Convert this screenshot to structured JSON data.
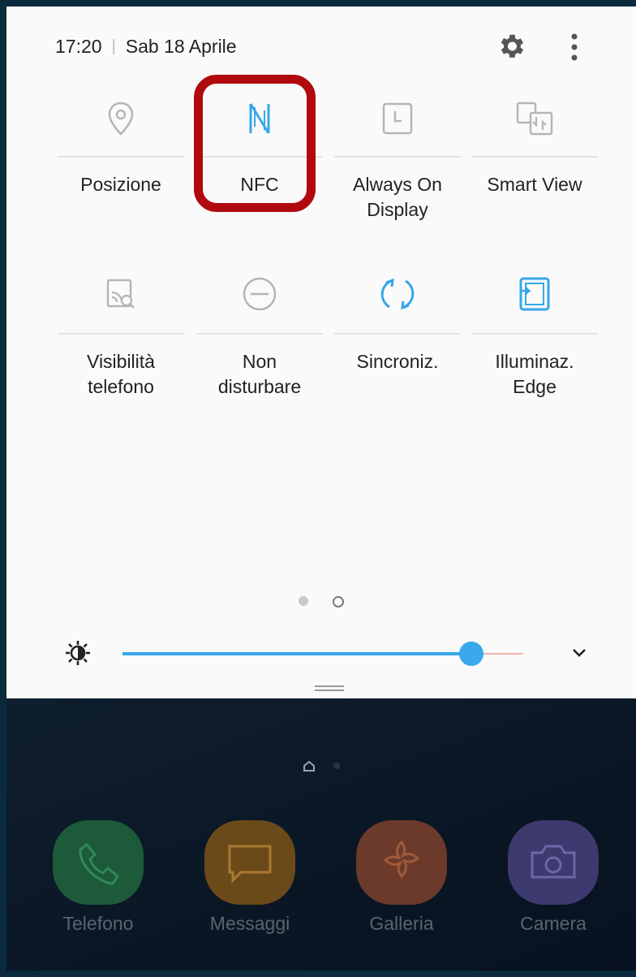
{
  "status_bar": {
    "time": "17:20",
    "date": "Sab 18 Aprile"
  },
  "tiles": [
    {
      "label": "Posizione",
      "icon": "location-icon",
      "active": false
    },
    {
      "label": "NFC",
      "icon": "nfc-icon",
      "active": true
    },
    {
      "label": "Always On\nDisplay",
      "icon": "always-on-display-icon",
      "active": false
    },
    {
      "label": "Smart View",
      "icon": "smart-view-icon",
      "active": false
    },
    {
      "label": "Visibilità\ntelefono",
      "icon": "phone-visibility-icon",
      "active": false
    },
    {
      "label": "Non\ndisturbare",
      "icon": "do-not-disturb-icon",
      "active": false
    },
    {
      "label": "Sincroniz.",
      "icon": "sync-icon",
      "active": true
    },
    {
      "label": "Illuminaz.\nEdge",
      "icon": "edge-lighting-icon",
      "active": true
    }
  ],
  "pager": {
    "current": 1,
    "total": 2
  },
  "brightness": {
    "level": 0.87
  },
  "colors": {
    "accent": "#35a7e8",
    "highlight": "#b00a0e",
    "inactive_icon": "#b5b5b5"
  },
  "dock": [
    {
      "label": "Telefono",
      "icon": "phone-icon",
      "color": "#1d5a3a"
    },
    {
      "label": "Messaggi",
      "icon": "message-icon",
      "color": "#6b4a1a"
    },
    {
      "label": "Galleria",
      "icon": "gallery-icon",
      "color": "#6b3a2a"
    },
    {
      "label": "Camera",
      "icon": "camera-icon",
      "color": "#3c3a6e"
    }
  ]
}
